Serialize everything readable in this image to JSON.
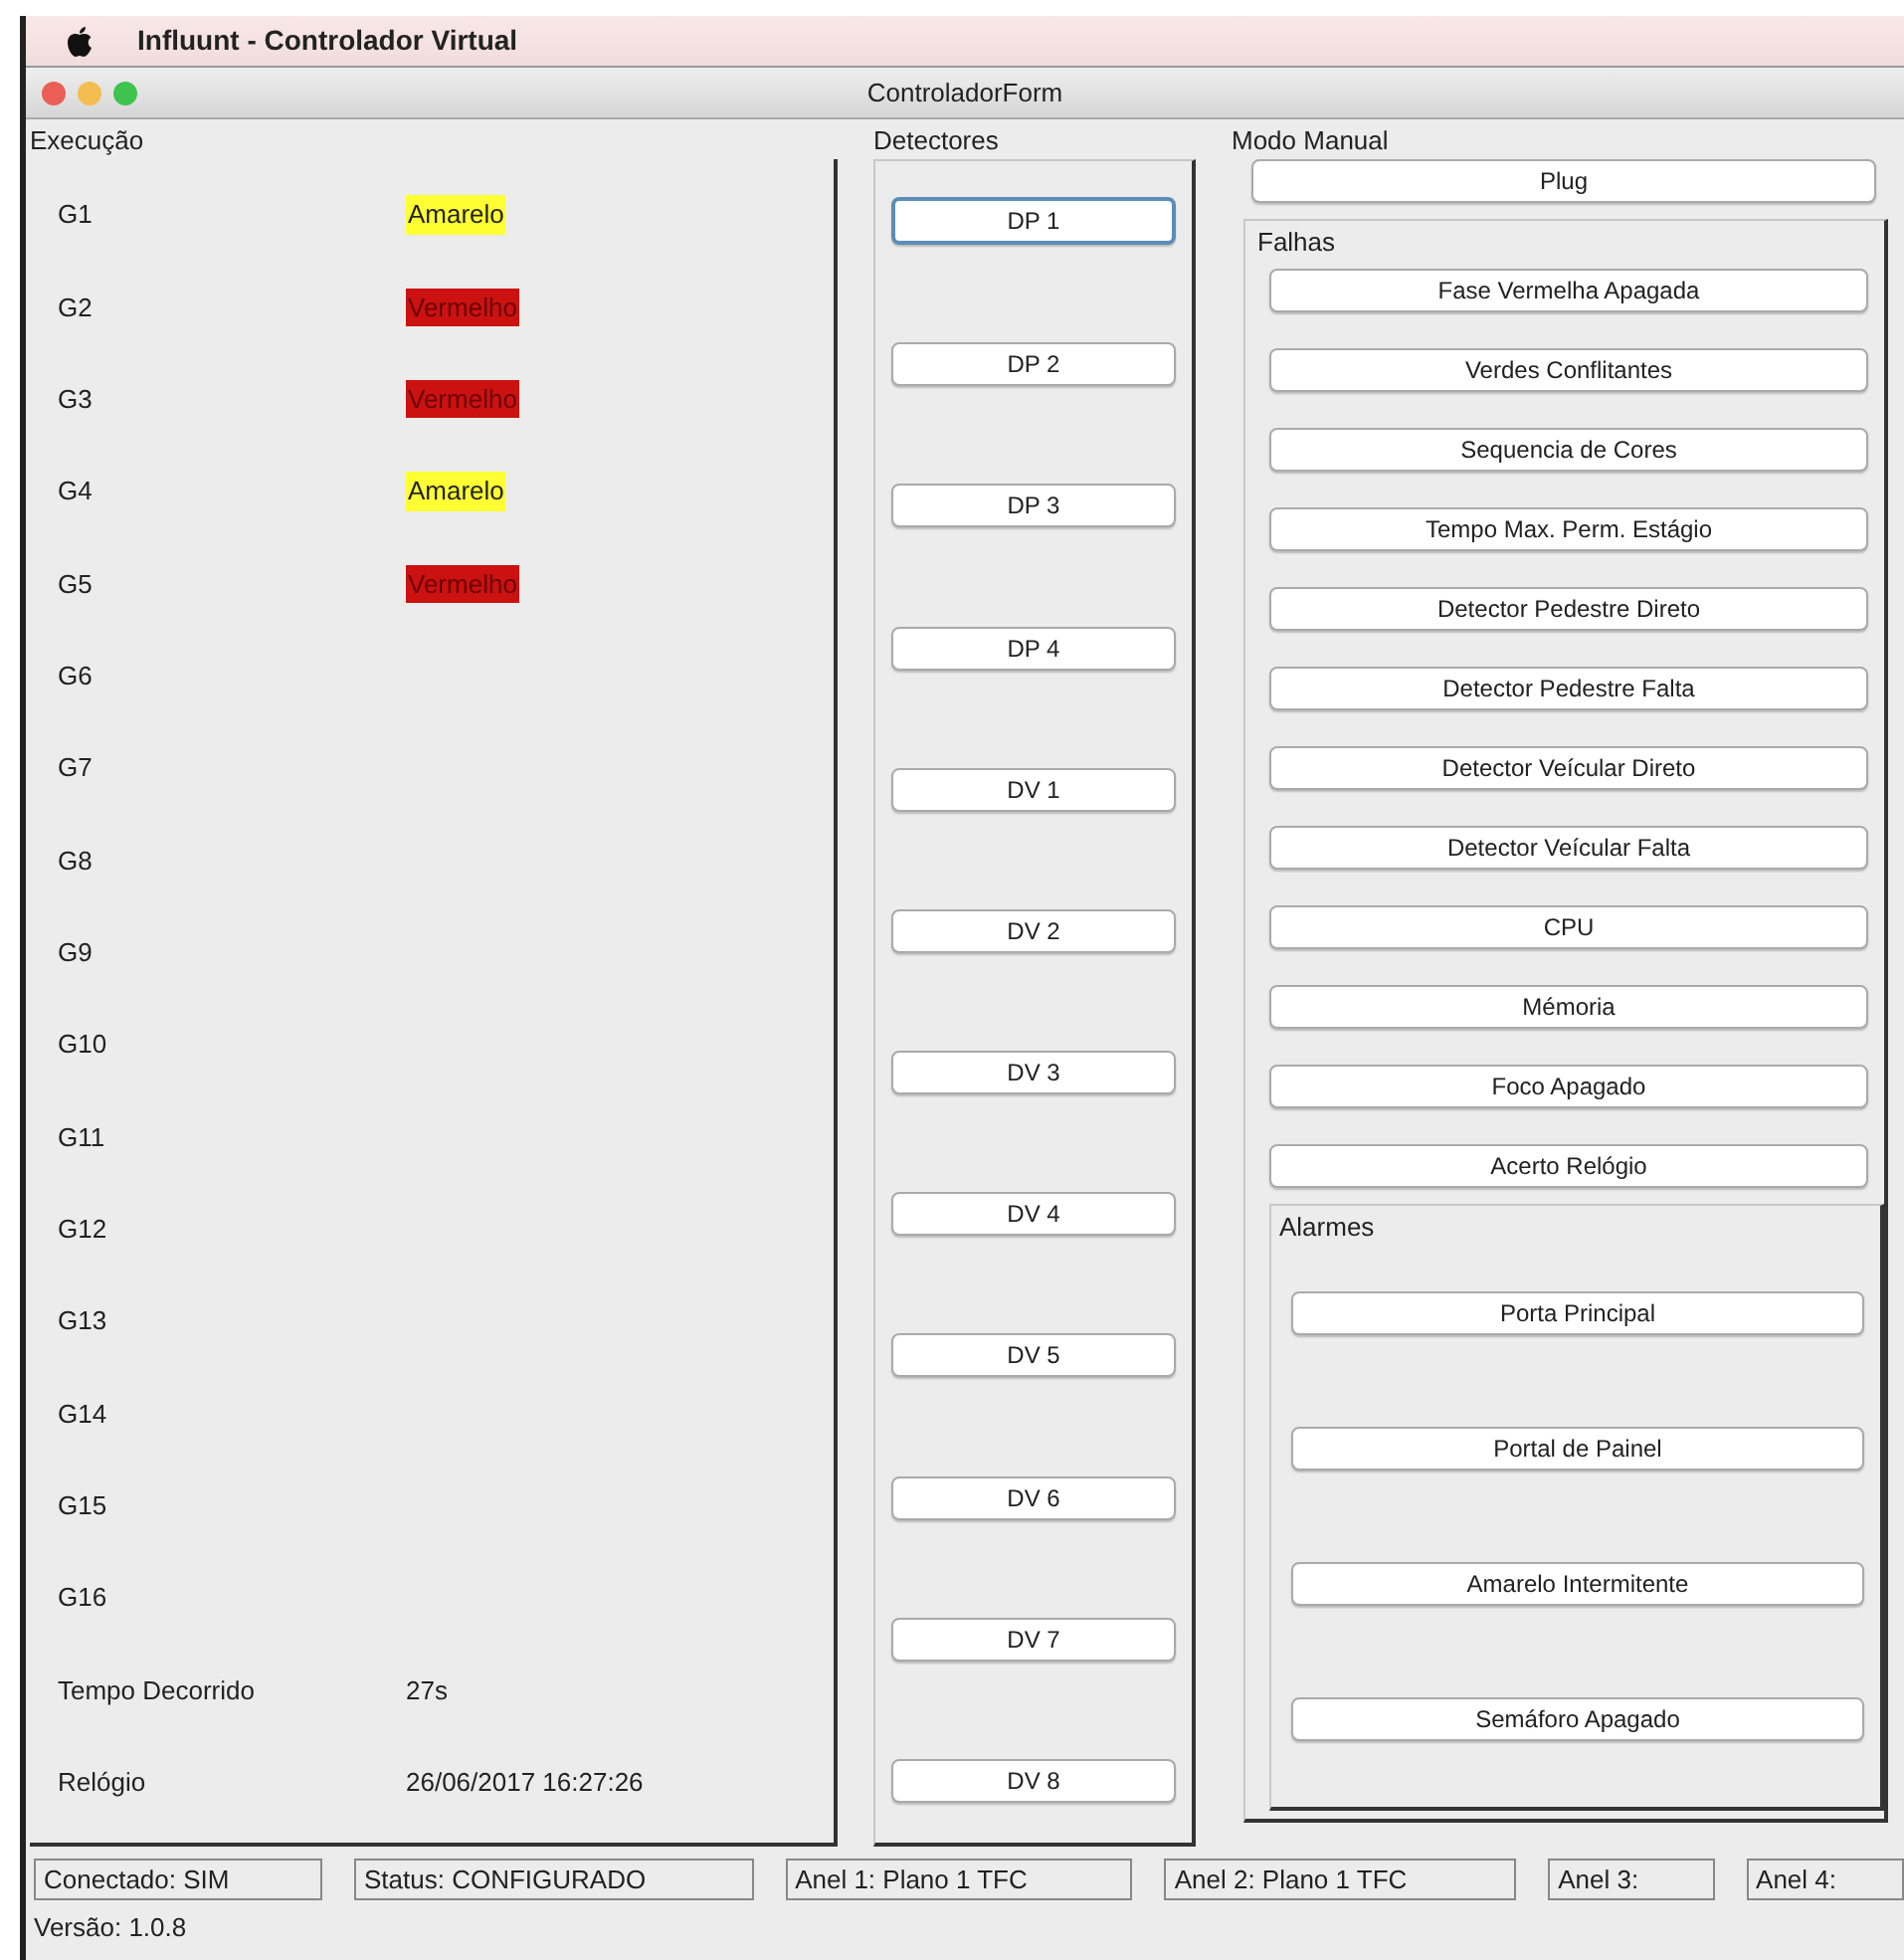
{
  "window": {
    "app_title": "Influunt - Controlador Virtual",
    "title": "ControladorForm"
  },
  "execucao": {
    "label": "Execução",
    "groups": [
      {
        "name": "G1",
        "signal": {
          "text": "Amarelo",
          "color": "#ffff33"
        }
      },
      {
        "name": "G2",
        "signal": {
          "text": "Vermelho",
          "color": "#cc1111"
        }
      },
      {
        "name": "G3",
        "signal": {
          "text": "Vermelho",
          "color": "#cc1111"
        }
      },
      {
        "name": "G4",
        "signal": {
          "text": "Amarelo",
          "color": "#ffff33"
        }
      },
      {
        "name": "G5",
        "signal": {
          "text": "Vermelho",
          "color": "#cc1111"
        }
      },
      {
        "name": "G6"
      },
      {
        "name": "G7"
      },
      {
        "name": "G8"
      },
      {
        "name": "G9"
      },
      {
        "name": "G10"
      },
      {
        "name": "G11"
      },
      {
        "name": "G12"
      },
      {
        "name": "G13"
      },
      {
        "name": "G14"
      },
      {
        "name": "G15"
      },
      {
        "name": "G16"
      }
    ],
    "info": [
      {
        "label": "Tempo Decorrido",
        "value": "27s"
      },
      {
        "label": "Relógio",
        "value": "26/06/2017 16:27:26"
      }
    ]
  },
  "detectores": {
    "label": "Detectores",
    "buttons": [
      {
        "label": "DP 1",
        "focused": true
      },
      {
        "label": "DP 2",
        "focused": false
      },
      {
        "label": "DP 3",
        "focused": false
      },
      {
        "label": "DP 4",
        "focused": false
      },
      {
        "label": "DV 1",
        "focused": false
      },
      {
        "label": "DV 2",
        "focused": false
      },
      {
        "label": "DV 3",
        "focused": false
      },
      {
        "label": "DV 4",
        "focused": false
      },
      {
        "label": "DV 5",
        "focused": false
      },
      {
        "label": "DV 6",
        "focused": false
      },
      {
        "label": "DV 7",
        "focused": false
      },
      {
        "label": "DV 8",
        "focused": false
      }
    ]
  },
  "modo_manual": {
    "label": "Modo Manual",
    "plug_button": "Plug",
    "falhas": {
      "label": "Falhas",
      "buttons": [
        "Fase Vermelha Apagada",
        "Verdes Conflitantes",
        "Sequencia de Cores",
        "Tempo Max. Perm. Estágio",
        "Detector Pedestre Direto",
        "Detector Pedestre Falta",
        "Detector Veícular Direto",
        "Detector Veícular Falta",
        "CPU",
        "Mémoria",
        "Foco Apagado",
        "Acerto Relógio"
      ]
    },
    "alarmes": {
      "label": "Alarmes",
      "buttons": [
        "Porta Principal",
        "Portal de Painel",
        "Amarelo Intermitente",
        "Semáforo Apagado"
      ]
    }
  },
  "status_bar": {
    "fields": [
      "Conectado: SIM",
      "Status: CONFIGURADO",
      "Anel 1: Plano 1 TFC",
      "Anel 2: Plano 1 TFC",
      "Anel 3:",
      "Anel 4:"
    ],
    "version": "Versão: 1.0.8"
  }
}
